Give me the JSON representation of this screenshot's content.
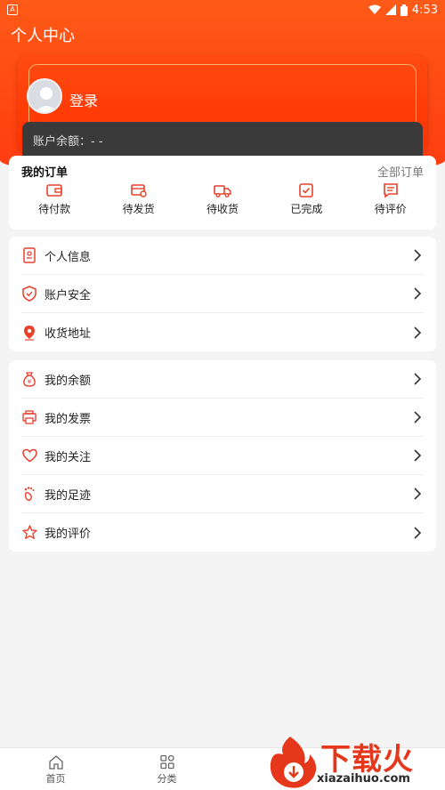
{
  "status_bar": {
    "time": "4:53"
  },
  "header": {
    "title": "个人中心"
  },
  "profile": {
    "login_label": "登录",
    "balance_text": "账户余额：- -"
  },
  "orders": {
    "title": "我的订单",
    "all_link": "全部订单",
    "items": [
      {
        "label": "待付款",
        "icon": "wallet-icon"
      },
      {
        "label": "待发货",
        "icon": "shipping-box-icon"
      },
      {
        "label": "待收货",
        "icon": "truck-icon"
      },
      {
        "label": "已完成",
        "icon": "completed-check-icon"
      },
      {
        "label": "待评价",
        "icon": "review-message-icon"
      }
    ]
  },
  "account_menu": [
    {
      "label": "个人信息",
      "icon": "profile-document-icon"
    },
    {
      "label": "账户安全",
      "icon": "shield-check-icon"
    },
    {
      "label": "收货地址",
      "icon": "location-pin-icon"
    }
  ],
  "my_menu": [
    {
      "label": "我的余额",
      "icon": "money-bag-icon"
    },
    {
      "label": "我的发票",
      "icon": "invoice-printer-icon"
    },
    {
      "label": "我的关注",
      "icon": "heart-icon"
    },
    {
      "label": "我的足迹",
      "icon": "footprint-icon"
    },
    {
      "label": "我的评价",
      "icon": "star-icon"
    }
  ],
  "tabbar": {
    "items": [
      {
        "label": "首页",
        "icon": "home-icon"
      },
      {
        "label": "分类",
        "icon": "category-grid-icon"
      }
    ]
  },
  "watermark": {
    "text": "下载火",
    "url": "xiazaihuo.com"
  },
  "colors": {
    "brand": "#ff4a12",
    "accent_icon": "#e8402b",
    "balance_bg": "#3a3a3a"
  }
}
